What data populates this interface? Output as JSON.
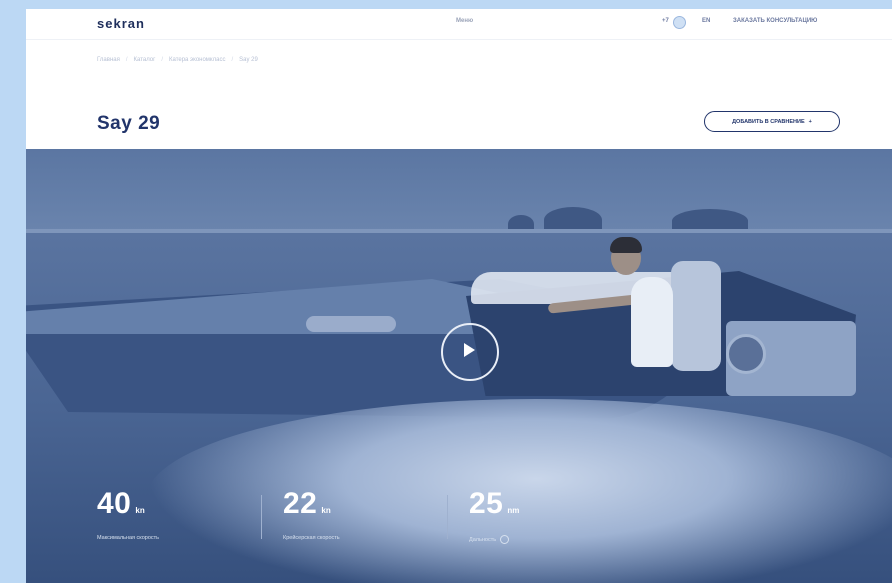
{
  "header": {
    "logo": "sekran",
    "center_link": "Меню",
    "phone": "+7",
    "lang": "EN",
    "consult": "ЗАКАЗАТЬ КОНСУЛЬТАЦИЮ"
  },
  "breadcrumb": [
    "Главная",
    "Каталог",
    "Катера экономкласс",
    "Say 29"
  ],
  "page": {
    "title": "Say 29",
    "compare_button": "ДОБАВИТЬ В СРАВНЕНИЕ",
    "compare_symbol": "+"
  },
  "stats": [
    {
      "value": "40",
      "unit": "kn",
      "label": "Максимальная скорость"
    },
    {
      "value": "22",
      "unit": "kn",
      "label": "Крейсерская скорость"
    },
    {
      "value": "25",
      "unit": "nm",
      "label": "Дальность"
    }
  ],
  "icons": {
    "play": "play-icon",
    "globe": "globe-icon",
    "info": "info-icon"
  },
  "colors": {
    "brand": "#22356b",
    "accent_bg": "#bcd8f4"
  }
}
